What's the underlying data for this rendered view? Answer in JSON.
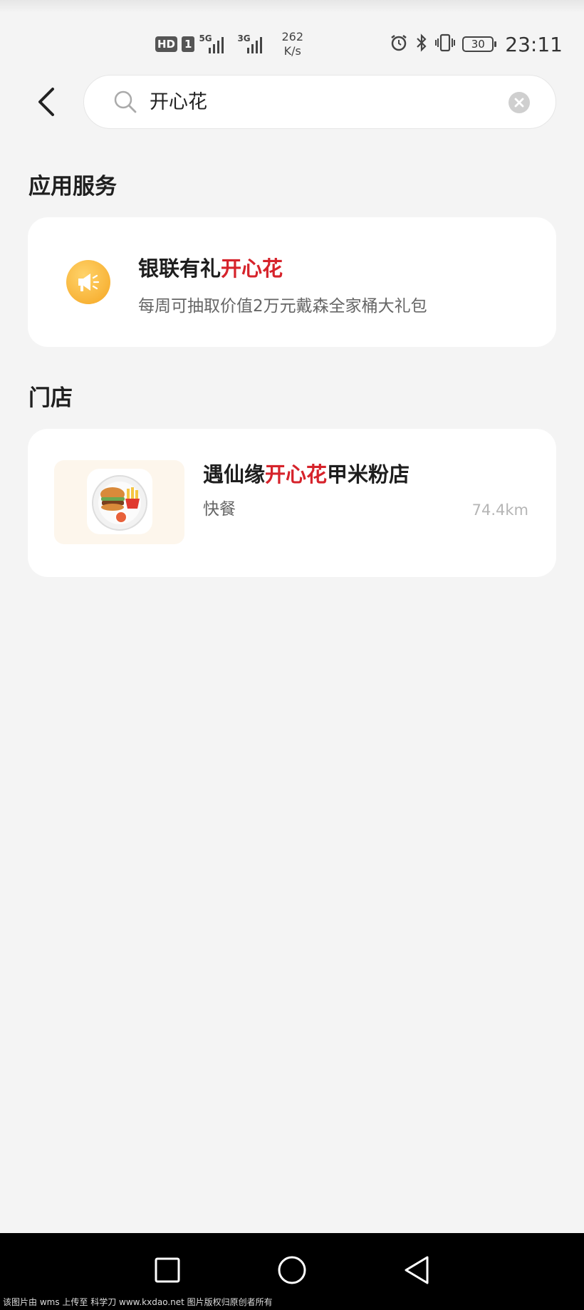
{
  "status_bar": {
    "hd_label": "HD",
    "sim_label": "1",
    "network_1": "5G",
    "network_2": "3G",
    "speed_value": "262",
    "speed_unit": "K/s",
    "battery": "30",
    "time": "23:11"
  },
  "search": {
    "query": "开心花"
  },
  "sections": {
    "services_title": "应用服务",
    "stores_title": "门店"
  },
  "service_item": {
    "title_prefix": "银联有礼",
    "title_highlight": "开心花",
    "description": "每周可抽取价值2万元戴森全家桶大礼包",
    "icon": "megaphone-icon",
    "icon_color": "#f5a623"
  },
  "store_item": {
    "name_prefix": "遇仙缘",
    "name_highlight": "开心花",
    "name_suffix": "甲米粉店",
    "category": "快餐",
    "distance": "74.4km",
    "thumbnail": "burger-fries-plate-image"
  },
  "colors": {
    "highlight": "#d6232b",
    "background": "#f4f4f4"
  },
  "watermark": "该图片由 wms 上传至 科学刀 www.kxdao.net 图片版权归原创者所有"
}
